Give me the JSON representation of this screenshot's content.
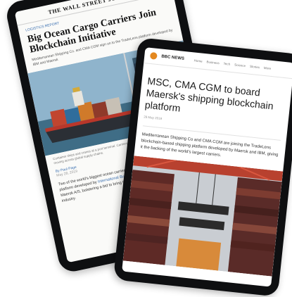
{
  "back_tablet": {
    "masthead": "THE WALL STREET JOURNAL.",
    "kicker": "LOGISTICS REPORT",
    "headline": "Big Ocean Cargo Carriers Join Blockchain Initiative",
    "subhead": "Mediterranean Shipping Co. and CMA CGM sign on to the TradeLens platform developed by IBM and Maersk",
    "photo_caption": "Container ships and cranes at a port terminal. Carriers are adopting digital platforms to track cargo moving across global supply chains.",
    "byline": "By Paul Page",
    "byline_date": "May 28, 2019",
    "body_text_1": "Two of the world's biggest ocean carriers are joining a blockchain-based shipping platform developed by ",
    "body_link": "International Business Machines Corp.",
    "body_text_2": " and A.P. Moller-Maersk A/S, bolstering a bid to bring the technology to the container-shipping industry."
  },
  "front_tablet": {
    "site_name": "BBC NEWS",
    "nav_items": [
      "Home",
      "Business",
      "Tech",
      "Science",
      "Stories",
      "More"
    ],
    "headline": "MSC, CMA CGM to board Maersk's shipping blockchain platform",
    "meta": "28 May 2019",
    "lead": "Mediterranean Shipping Co and CMA CGM are joining the TradeLens blockchain-based shipping platform developed by Maersk and IBM, giving it the backing of the world's largest carriers."
  },
  "colors": {
    "tablet_bezel": "#0e0f11",
    "link_blue": "#3a6fb0",
    "logo_orange": "#e4881f"
  }
}
